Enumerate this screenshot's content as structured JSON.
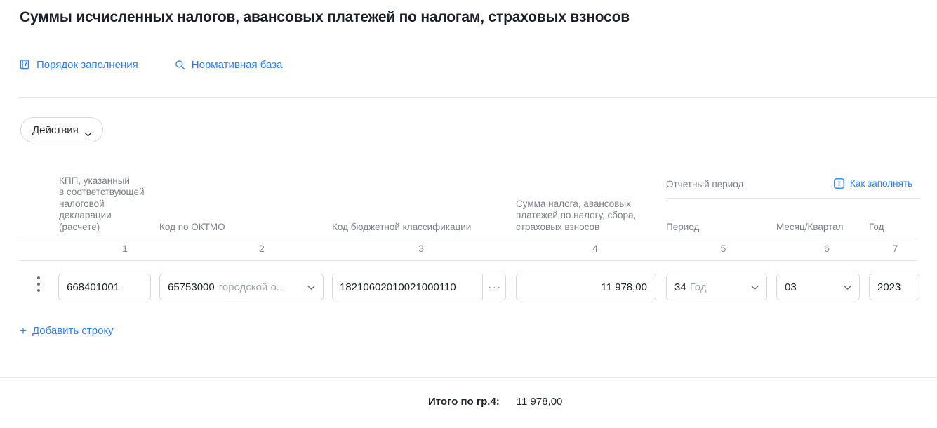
{
  "page_title": "Суммы исчисленных налогов, авансовых платежей по налогам, страховых взносов",
  "links": [
    {
      "label": "Порядок заполнения",
      "icon": "book-icon"
    },
    {
      "label": "Нормативная база",
      "icon": "search-icon"
    }
  ],
  "toolbar": {
    "actions_label": "Действия"
  },
  "table": {
    "group_header": {
      "label": "Отчетный период",
      "how_to_label": "Как заполнять",
      "how_to_icon": "info-icon"
    },
    "columns": [
      {
        "num": "1",
        "header": "КПП, указанный\nв соответствующей\nналоговой\nдекларации\n(расчете)"
      },
      {
        "num": "2",
        "header": "Код по ОКТМО"
      },
      {
        "num": "3",
        "header": "Код бюджетной классификации"
      },
      {
        "num": "4",
        "header": "Сумма налога, авансовых\nплатежей по налогу, сбора,\nстраховых взносов"
      },
      {
        "num": "5",
        "header": "Период"
      },
      {
        "num": "6",
        "header": "Месяц/Квартал"
      },
      {
        "num": "7",
        "header": "Год"
      }
    ],
    "rows": [
      {
        "kpp": "668401001",
        "oktmo_code": "65753000",
        "oktmo_name": "городской о...",
        "kbk": "18210602010021000110",
        "kbk_more_label": "···",
        "amount": "11 978,00",
        "period_code": "34",
        "period_name": "Год",
        "month_quarter": "03",
        "year": "2023"
      }
    ],
    "add_row_label": "Добавить строку",
    "add_row_icon": "plus-icon"
  },
  "footer": {
    "total_label": "Итого по гр.4:",
    "total_value": "11 978,00"
  },
  "colors": {
    "link": "#2d7ff9",
    "text": "#1f2229",
    "muted": "#7b8088",
    "border": "#d5d8dd",
    "divider": "#e3e5e8"
  }
}
